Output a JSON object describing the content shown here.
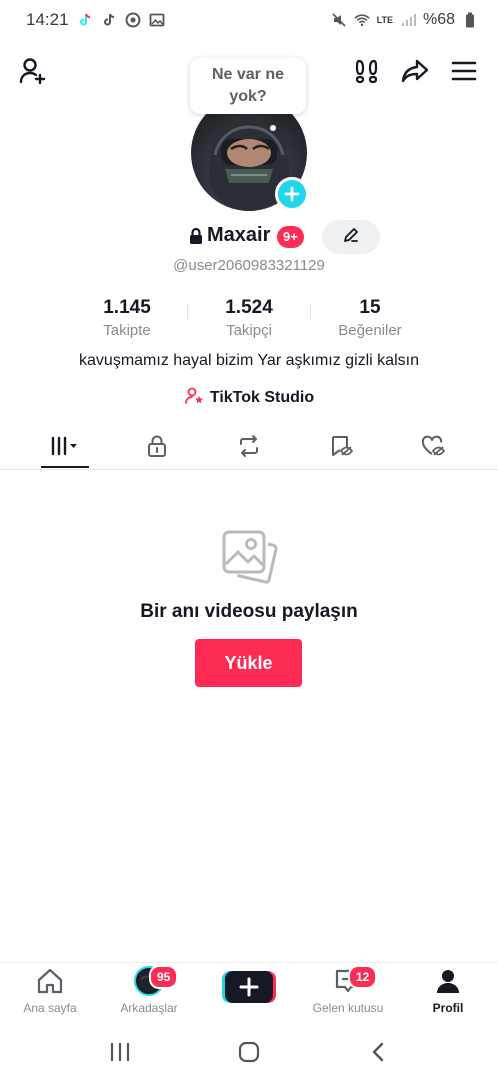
{
  "status_bar": {
    "time": "14:21",
    "battery": "%68",
    "network": "LTE"
  },
  "bubble": {
    "text": "Ne var ne yok?"
  },
  "profile": {
    "username": "Maxair",
    "notification_count": "9+",
    "handle": "@user2060983321129",
    "bio": "kavuşmamız hayal bizim Yar aşkımız gizli kalsın",
    "studio_label": "TikTok Studio"
  },
  "stats": [
    {
      "value": "1.145",
      "label": "Takipte"
    },
    {
      "value": "1.524",
      "label": "Takipçi"
    },
    {
      "value": "15",
      "label": "Beğeniler"
    }
  ],
  "empty_state": {
    "title": "Bir anı videosu paylaşın",
    "button": "Yükle"
  },
  "bottom_nav": [
    {
      "label": "Ana sayfa",
      "icon": "home-icon"
    },
    {
      "label": "Arkadaşlar",
      "icon": "friends-avatar",
      "badge": "95"
    },
    {
      "label": "",
      "icon": "create-icon"
    },
    {
      "label": "Gelen kutusu",
      "icon": "inbox-icon",
      "badge": "12"
    },
    {
      "label": "Profil",
      "icon": "profile-icon"
    }
  ],
  "colors": {
    "accent": "#fe2c55",
    "cyan": "#20d5ec",
    "text": "#161823",
    "secondary": "#8a8b91"
  }
}
